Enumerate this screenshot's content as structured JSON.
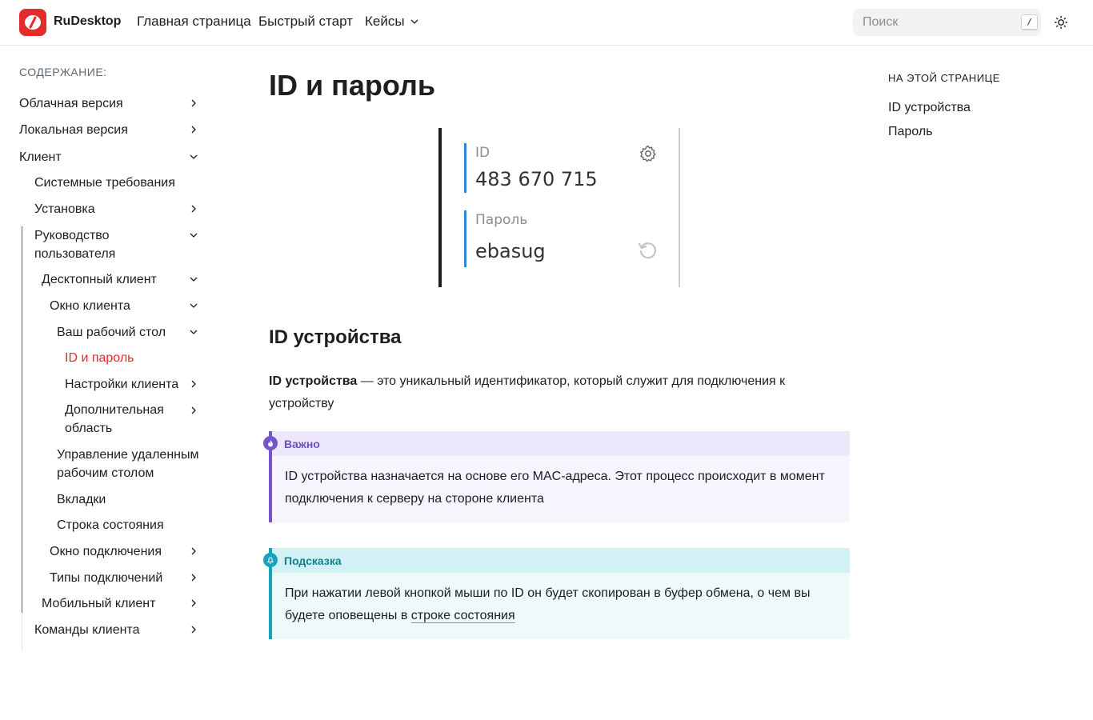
{
  "header": {
    "brand": "RuDesktop",
    "nav": {
      "home": "Главная страница",
      "quick_start": "Быстрый старт",
      "cases": "Кейсы"
    },
    "search": {
      "placeholder": "Поиск",
      "shortcut": "/"
    }
  },
  "sidebar": {
    "title": "СОДЕРЖАНИЕ:",
    "items": {
      "cloud": "Облачная версия",
      "local": "Локальная версия",
      "client": "Клиент",
      "system_req": "Системные требования",
      "install": "Установка",
      "user_guide_1": "Руководство",
      "user_guide_2": "пользователя",
      "desktop_client": "Десктопный клиент",
      "client_window": "Окно клиента",
      "your_desktop": "Ваш рабочий стол",
      "id_password": "ID и пароль",
      "client_settings": "Настройки клиента",
      "extra_area_1": "Дополнительная",
      "extra_area_2": "область",
      "remote_mgmt_1": "Управление удаленным",
      "remote_mgmt_2": "рабочим столом",
      "tabs": "Вкладки",
      "status_bar": "Строка состояния",
      "connection_window": "Окно подключения",
      "connection_types": "Типы подключений",
      "mobile_client": "Мобильный клиент",
      "client_commands": "Команды клиента"
    }
  },
  "main": {
    "title": "ID и пароль",
    "screenshot": {
      "id_label": "ID",
      "id_value": "483 670 715",
      "password_label": "Пароль",
      "password_value": "ebasug"
    },
    "section_title": "ID устройства",
    "intro_bold": "ID устройства",
    "intro_rest": " — это уникальный идентификатор, который служит для подключения к устройству",
    "important": {
      "title": "Важно",
      "text": "ID устройства назначается на основе его MAC-адреса. Этот процесс происходит в момент подключения к серверу на стороне клиента"
    },
    "tip": {
      "title": "Подсказка",
      "text_before": "При нажатии левой кнопкой мыши по ID он будет скопирован в буфер обмена, о чем вы будете оповещены в ",
      "link": "строке состояния"
    }
  },
  "toc": {
    "title": "НА ЭТОЙ СТРАНИЦЕ",
    "items": {
      "device_id": "ID устройства",
      "password": "Пароль"
    }
  },
  "colors": {
    "brand": "#e32b2b",
    "important": "#7356cc",
    "tip": "#16a4bc"
  }
}
